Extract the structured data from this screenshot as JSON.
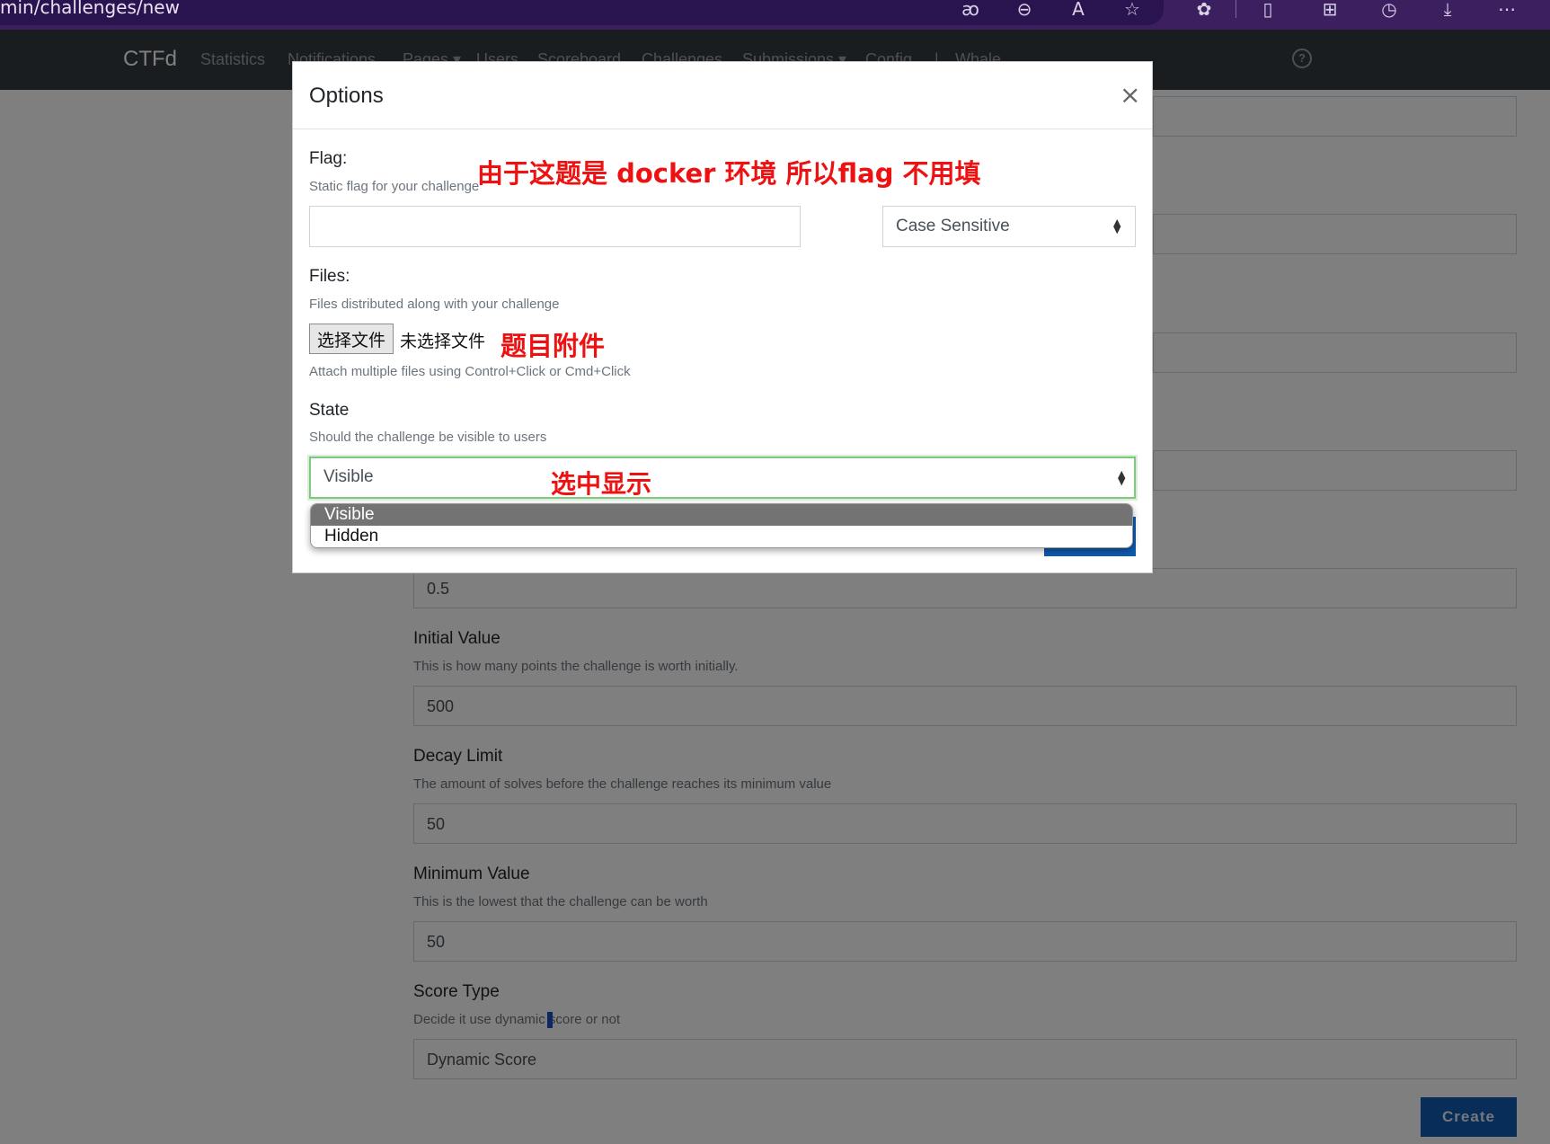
{
  "browser": {
    "url": "min/challenges/new",
    "icons": [
      "translate-icon",
      "zoom-out-icon",
      "read-aloud-icon",
      "favorite-star-icon",
      "extensions-icon",
      "split-screen-icon",
      "collections-icon",
      "history-icon",
      "download-icon",
      "more-icon"
    ]
  },
  "navbar": {
    "brand": "CTFd",
    "links": [
      "Statistics",
      "Notifications",
      "Pages ▾",
      "Users",
      "Scoreboard",
      "Challenges",
      "Submissions ▾",
      "Config",
      "Whale"
    ],
    "separator": "|"
  },
  "background_form": {
    "decay_value": "0.5",
    "initial_value": {
      "label": "Initial Value",
      "help": "This is how many points the challenge is worth initially.",
      "value": "500"
    },
    "decay_limit": {
      "label": "Decay Limit",
      "help": "The amount of solves before the challenge reaches its minimum value",
      "value": "50"
    },
    "minimum_value": {
      "label": "Minimum Value",
      "help": "This is the lowest that the challenge can be worth",
      "value": "50"
    },
    "score_type": {
      "label": "Score Type",
      "help": "Decide it use dynamic score or not",
      "value": "Dynamic Score"
    },
    "create_label": "Create"
  },
  "modal": {
    "title": "Options",
    "close": "×",
    "flag": {
      "label": "Flag:",
      "help": "Static flag for your challenge",
      "value": "",
      "case_option": "Case Sensitive"
    },
    "files": {
      "label": "Files:",
      "help": "Files distributed along with your challenge",
      "button": "选择文件",
      "status": "未选择文件",
      "hint": "Attach multiple files using Control+Click or Cmd+Click"
    },
    "state": {
      "label": "State",
      "help": "Should the challenge be visible to users",
      "value": "Visible",
      "options": [
        "Visible",
        "Hidden"
      ]
    }
  },
  "annotations": {
    "flag_note": "由于这题是 docker 环境 所以flag 不用填",
    "files_note": "题目附件",
    "state_note": "选中显示"
  },
  "colors": {
    "annotation": "#ee1111",
    "navbar": "#343a40",
    "primary": "#0e5ab0",
    "browser": "#3b1f5f"
  }
}
